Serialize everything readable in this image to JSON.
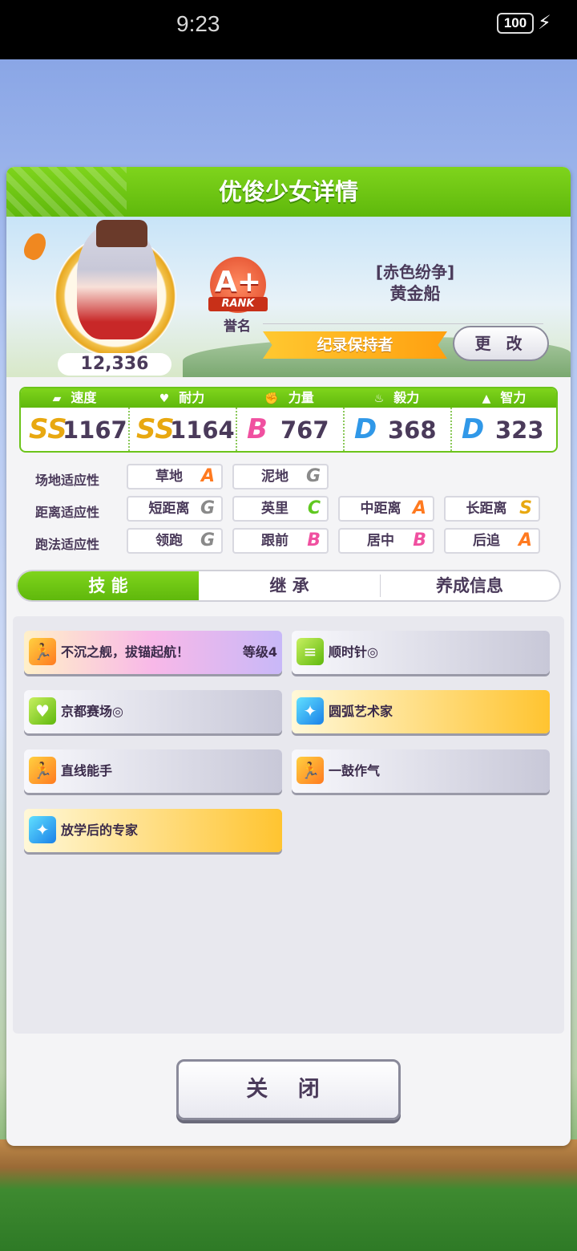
{
  "status_bar": {
    "time": "9:23",
    "battery": "100"
  },
  "header": {
    "title": "优俊少女详情"
  },
  "profile": {
    "fans": "12,336",
    "rank": "A+",
    "rank_ribbon": "RANK",
    "rank_label": "誉名",
    "epithet": "[赤色纷争]",
    "name": "黄金船",
    "title_badge": "纪录保持者",
    "change_button": "更 改"
  },
  "stats": [
    {
      "label": "速度",
      "icon": "shoe-icon",
      "grade": "SS",
      "value": "1167"
    },
    {
      "label": "耐力",
      "icon": "heart-icon",
      "grade": "SS",
      "value": "1164"
    },
    {
      "label": "力量",
      "icon": "muscle-icon",
      "grade": "B",
      "value": "767"
    },
    {
      "label": "毅力",
      "icon": "flame-icon",
      "grade": "D",
      "value": "368"
    },
    {
      "label": "智力",
      "icon": "graduation-cap-icon",
      "grade": "D",
      "value": "323"
    }
  ],
  "aptitudes": {
    "track": {
      "label": "场地适应性",
      "items": [
        {
          "name": "草地",
          "grade": "A"
        },
        {
          "name": "泥地",
          "grade": "G"
        }
      ]
    },
    "distance": {
      "label": "距离适应性",
      "items": [
        {
          "name": "短距离",
          "grade": "G"
        },
        {
          "name": "英里",
          "grade": "C"
        },
        {
          "name": "中距离",
          "grade": "A"
        },
        {
          "name": "长距离",
          "grade": "S"
        }
      ]
    },
    "style": {
      "label": "跑法适应性",
      "items": [
        {
          "name": "领跑",
          "grade": "G"
        },
        {
          "name": "跟前",
          "grade": "B"
        },
        {
          "name": "居中",
          "grade": "B"
        },
        {
          "name": "后追",
          "grade": "A"
        }
      ]
    }
  },
  "tabs": [
    {
      "label": "技 能",
      "active": true
    },
    {
      "label": "继 承",
      "active": false
    },
    {
      "label": "养成信息",
      "active": false
    }
  ],
  "skills": [
    {
      "name": "不沉之舰，拔锚起航！",
      "level": "等级4",
      "style": "unique",
      "icon": "runner-icon"
    },
    {
      "name": "顺时针◎",
      "level": "",
      "style": "normal",
      "icon": "document-icon"
    },
    {
      "name": "京都赛场◎",
      "level": "",
      "style": "normal",
      "icon": "heart-icon"
    },
    {
      "name": "圆弧艺术家",
      "level": "",
      "style": "gold",
      "icon": "sparkle-icon"
    },
    {
      "name": "直线能手",
      "level": "",
      "style": "normal",
      "icon": "runner-icon"
    },
    {
      "name": "一鼓作气",
      "level": "",
      "style": "normal",
      "icon": "runner-icon"
    },
    {
      "name": "放学后的专家",
      "level": "",
      "style": "gold",
      "icon": "sparkle-icon"
    }
  ],
  "close_button": "关 闭"
}
